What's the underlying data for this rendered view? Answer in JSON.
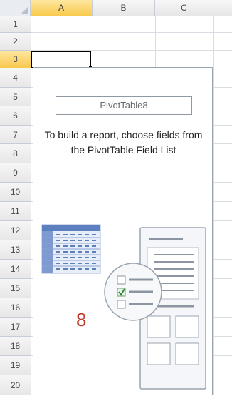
{
  "columns": [
    "A",
    "B",
    "C"
  ],
  "rows": [
    "1",
    "2",
    "3",
    "4",
    "5",
    "6",
    "7",
    "8",
    "9",
    "10",
    "11",
    "12",
    "13",
    "14",
    "15",
    "16",
    "17",
    "18",
    "19",
    "20"
  ],
  "active": {
    "column": "A",
    "row": "3"
  },
  "pivot": {
    "name": "PivotTable8",
    "instructions": "To build a report, choose fields from the PivotTable Field List"
  },
  "annotation": {
    "number": "8"
  },
  "colors": {
    "active_header": "#f8c94d",
    "header_bg": "#f0f0f0",
    "grid_line": "#d9dde3",
    "annotation": "#c0392b"
  },
  "icons": [
    "pivot-table-layout-icon",
    "field-list-checkbox-icon",
    "select-all-corner-icon"
  ]
}
